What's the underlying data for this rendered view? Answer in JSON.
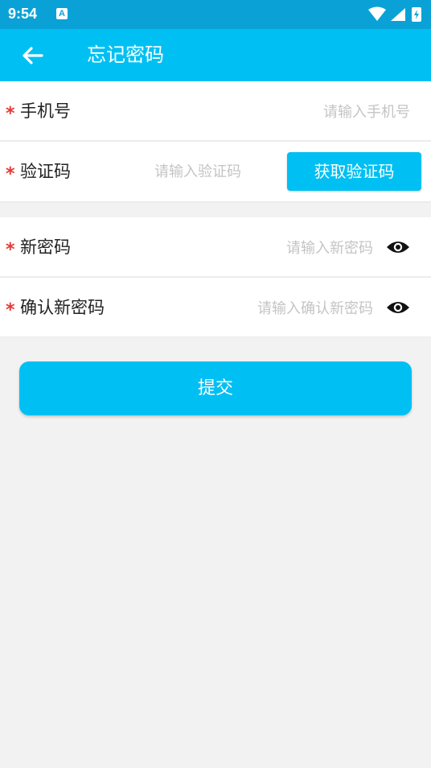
{
  "status_bar": {
    "time": "9:54",
    "notification_badge": "A"
  },
  "app_bar": {
    "title": "忘记密码",
    "back_icon": "arrow-left-icon"
  },
  "form": {
    "required_mark": "*",
    "phone": {
      "label": "手机号",
      "placeholder": "请输入手机号"
    },
    "code": {
      "label": "验证码",
      "placeholder": "请输入验证码",
      "button": "获取验证码"
    },
    "new_password": {
      "label": "新密码",
      "placeholder": "请输入新密码",
      "toggle_icon": "eye-icon"
    },
    "confirm_password": {
      "label": "确认新密码",
      "placeholder": "请输入确认新密码",
      "toggle_icon": "eye-icon"
    }
  },
  "submit": {
    "label": "提交"
  },
  "colors": {
    "primary": "#00c0f3",
    "status_bar": "#0aa2d6",
    "required": "#e53935",
    "placeholder": "#c4c4c4",
    "background": "#f2f2f2"
  }
}
